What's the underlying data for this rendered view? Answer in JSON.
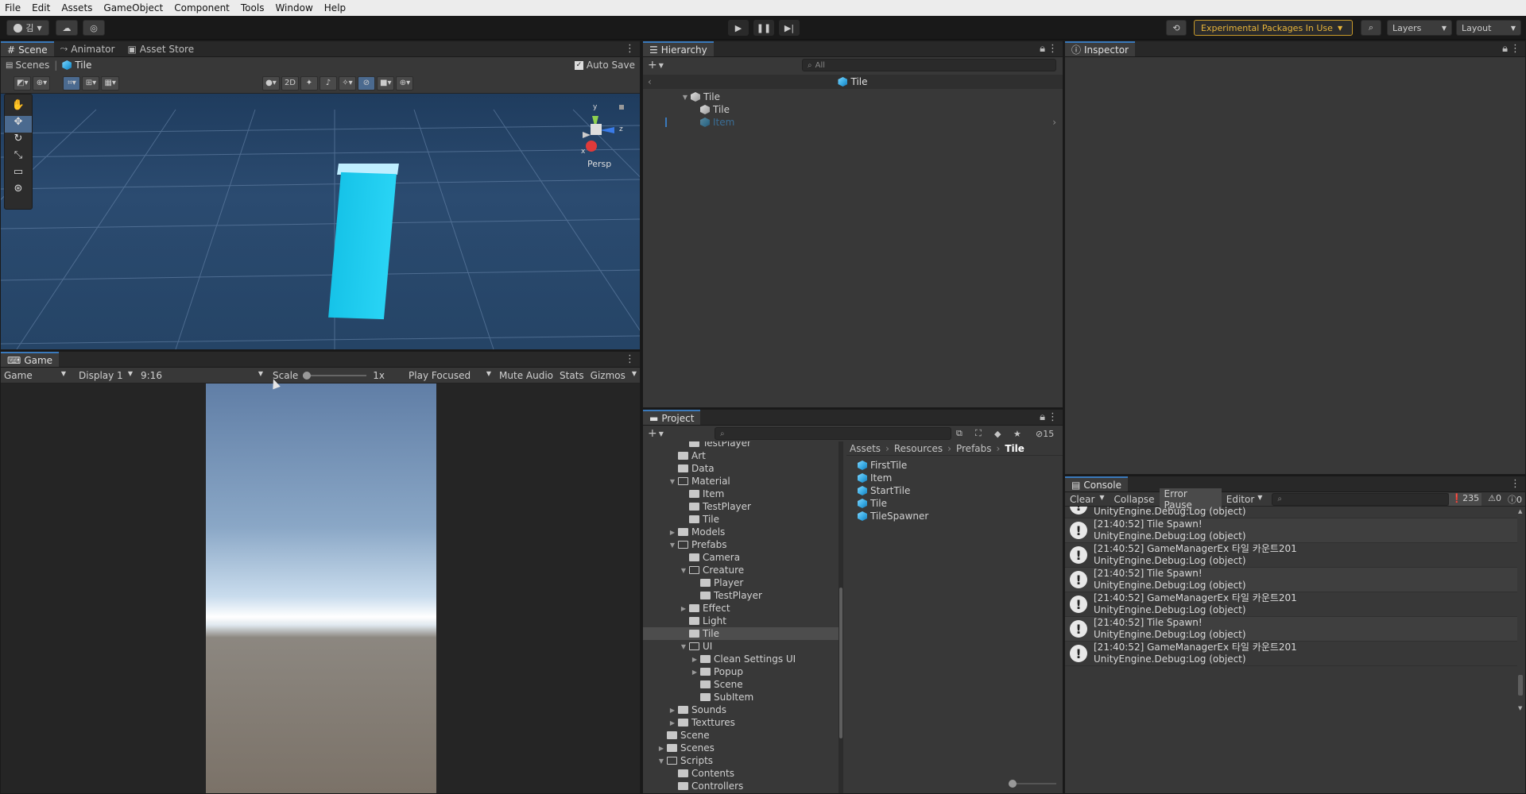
{
  "menu": [
    "File",
    "Edit",
    "Assets",
    "GameObject",
    "Component",
    "Tools",
    "Window",
    "Help"
  ],
  "toolbar": {
    "account": "김",
    "experimental": "Experimental Packages In Use",
    "layers": "Layers",
    "layout": "Layout"
  },
  "scene": {
    "tabs": [
      "Scene",
      "Animator",
      "Asset Store"
    ],
    "breadcrumb_root": "Scenes",
    "breadcrumb_current": "Tile",
    "auto_save": "Auto Save",
    "mode_2d": "2D",
    "persp": "Persp",
    "gizmo_x": "x",
    "gizmo_y": "y",
    "gizmo_z": "z"
  },
  "game": {
    "tab": "Game",
    "game_dropdown": "Game",
    "display": "Display 1",
    "aspect": "9:16",
    "scale_label": "Scale",
    "scale_value": "1x",
    "play_mode": "Play Focused",
    "mute_audio": "Mute Audio",
    "stats": "Stats",
    "gizmos": "Gizmos"
  },
  "hierarchy": {
    "tab": "Hierarchy",
    "search_placeholder": "All",
    "prefab_header": "Tile",
    "items": [
      {
        "label": "Tile",
        "depth": 0
      },
      {
        "label": "Tile",
        "depth": 1
      },
      {
        "label": "Item",
        "depth": 1
      }
    ]
  },
  "inspector": {
    "tab": "Inspector"
  },
  "project": {
    "tab": "Project",
    "hidden_count": "15",
    "breadcrumb": [
      "Assets",
      "Resources",
      "Prefabs",
      "Tile"
    ],
    "tree": [
      {
        "label": "TestPlayer",
        "depth": 3
      },
      {
        "label": "Art",
        "depth": 2
      },
      {
        "label": "Data",
        "depth": 2
      },
      {
        "label": "Material",
        "depth": 2,
        "open": true
      },
      {
        "label": "Item",
        "depth": 3
      },
      {
        "label": "TestPlayer",
        "depth": 3
      },
      {
        "label": "Tile",
        "depth": 3
      },
      {
        "label": "Models",
        "depth": 2,
        "closed": true
      },
      {
        "label": "Prefabs",
        "depth": 2,
        "open": true
      },
      {
        "label": "Camera",
        "depth": 3
      },
      {
        "label": "Creature",
        "depth": 3,
        "open": true
      },
      {
        "label": "Player",
        "depth": 4
      },
      {
        "label": "TestPlayer",
        "depth": 4
      },
      {
        "label": "Effect",
        "depth": 3,
        "closed": true
      },
      {
        "label": "Light",
        "depth": 3
      },
      {
        "label": "Tile",
        "depth": 3,
        "selected": true
      },
      {
        "label": "UI",
        "depth": 3,
        "open": true
      },
      {
        "label": "Clean Settings UI",
        "depth": 4,
        "closed": true
      },
      {
        "label": "Popup",
        "depth": 4,
        "closed": true
      },
      {
        "label": "Scene",
        "depth": 4
      },
      {
        "label": "SubItem",
        "depth": 4
      },
      {
        "label": "Sounds",
        "depth": 2,
        "closed": true
      },
      {
        "label": "Texttures",
        "depth": 2,
        "closed": true
      },
      {
        "label": "Scene",
        "depth": 1
      },
      {
        "label": "Scenes",
        "depth": 1,
        "closed": true
      },
      {
        "label": "Scripts",
        "depth": 1,
        "open": true
      },
      {
        "label": "Contents",
        "depth": 2
      },
      {
        "label": "Controllers",
        "depth": 2
      }
    ],
    "assets": [
      "FirstTile",
      "Item",
      "StartTile",
      "Tile",
      "TileSpawner"
    ]
  },
  "console": {
    "tab": "Console",
    "clear": "Clear",
    "collapse": "Collapse",
    "error_pause": "Error Pause",
    "editor": "Editor",
    "log_count": "235",
    "warn_count": "0",
    "error_count": "0",
    "partial_line": "UnityEngine.Debug:Log (object)",
    "logs": [
      {
        "line1": "[21:40:52] Tile Spawn!",
        "line2": "UnityEngine.Debug:Log (object)"
      },
      {
        "line1": "[21:40:52] GameManagerEx 타일 카운트201",
        "line2": "UnityEngine.Debug:Log (object)"
      },
      {
        "line1": "[21:40:52] Tile Spawn!",
        "line2": "UnityEngine.Debug:Log (object)"
      },
      {
        "line1": "[21:40:52] GameManagerEx 타일 카운트201",
        "line2": "UnityEngine.Debug:Log (object)"
      },
      {
        "line1": "[21:40:52] Tile Spawn!",
        "line2": "UnityEngine.Debug:Log (object)"
      },
      {
        "line1": "[21:40:52] GameManagerEx 타일 카운트201",
        "line2": "UnityEngine.Debug:Log (object)"
      }
    ]
  }
}
